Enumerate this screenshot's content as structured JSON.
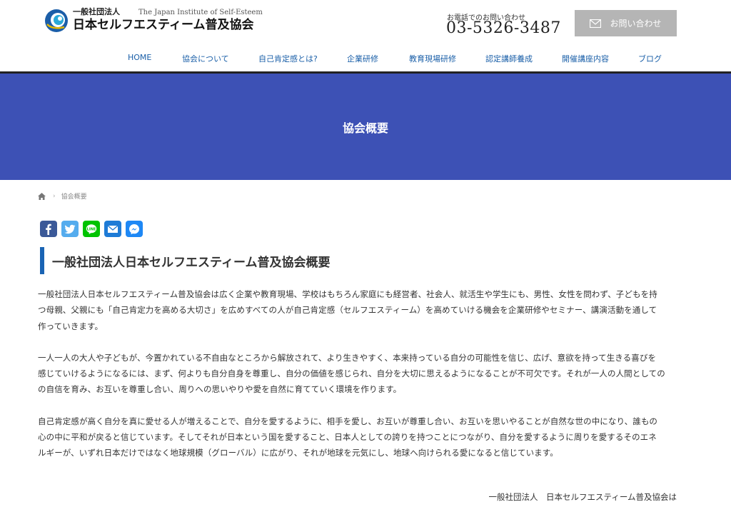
{
  "header": {
    "logo_small": "一般社団法人",
    "logo_en": "The Japan Institute of Self-Esteem",
    "logo_name": "日本セルフエスティーム普及協会",
    "contact_label": "お電話でのお問い合わせ",
    "phone": "03-5326-3487",
    "inquiry_label": "お問い合わせ"
  },
  "nav": [
    {
      "label": "HOME"
    },
    {
      "label": "協会について"
    },
    {
      "label": "自己肯定感とは?"
    },
    {
      "label": "企業研修"
    },
    {
      "label": "教育現場研修"
    },
    {
      "label": "認定講師養成"
    },
    {
      "label": "開催講座内容"
    },
    {
      "label": "ブログ"
    }
  ],
  "hero": {
    "title": "協会概要"
  },
  "breadcrumb": {
    "current": "協会概要"
  },
  "share": [
    "facebook-icon",
    "twitter-icon",
    "line-icon",
    "email-icon",
    "messenger-icon"
  ],
  "colors": {
    "hero_bg": "#3d51b5",
    "accent_bar": "#1a64b4",
    "nav_link": "#1a5fa8",
    "facebook": "#3b5998",
    "twitter": "#55acee",
    "line": "#00c300",
    "email": "#1e7bd6",
    "messenger": "#1e88f5"
  },
  "section": {
    "heading": "一般社団法人日本セルフエスティーム普及協会概要",
    "paragraphs": [
      [
        "一般社団法人日本セルフエスティーム普及協会は広く企業や教育現場、学校はもちろん家庭にも経営者、社会人、就活生や学生にも、男性、女性を問わず、子どもを持",
        "つ母親、父親にも「自己肯定力を高める大切さ」を広めすべての人が自己肯定感（セルフエスティーム）を高めていける機会を企業研修やセミナー、講演活動を通して",
        "作っていきます。"
      ],
      [
        "一人一人の大人や子どもが、今置かれている不自由なところから解放されて、より生きやすく、本来持っている自分の可能性を信じ、広げ、意欲を持って生きる喜びを",
        "感じていけるようになるには、まず、何よりも自分自身を尊重し、自分の価値を感じられ、自分を大切に思えるようになることが不可欠です。それが一人の人間としての",
        "の自信を育み、お互いを尊重し合い、周りへの思いやりや愛を自然に育てていく環境を作ります。"
      ],
      [
        "自己肯定感が高く自分を真に愛せる人が増えることで、自分を愛するように、相手を愛し、お互いが尊重し合い、お互いを思いやることが自然な世の中になり、誰もの",
        "心の中に平和が戻ると信じています。そしてそれが日本という国を愛すること、日本人としての誇りを持つことにつながり、自分を愛するように周りを愛するそのエネ",
        "ルギーが、いずれ日本だけではなく地球規模（グローバル）に広がり、それが地球を元気にし、地球へ向けられる愛になると信じています。"
      ]
    ],
    "signature": "一般社団法人　日本セルフエスティーム普及協会は"
  }
}
